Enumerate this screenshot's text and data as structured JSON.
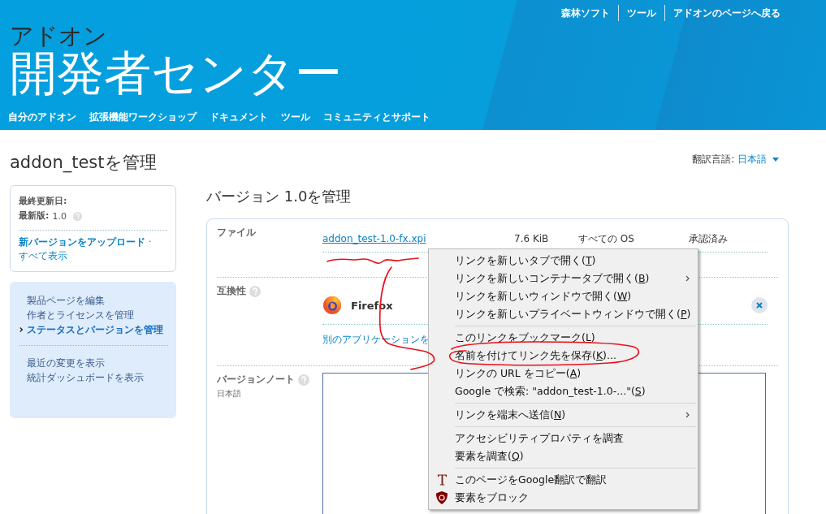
{
  "header": {
    "top_links": [
      "森林ソフト",
      "ツール",
      "アドオンのページへ戻る"
    ],
    "subtitle": "アドオン",
    "title": "開発者センター",
    "nav": [
      "自分のアドオン",
      "拡張機能ワークショップ",
      "ドキュメント",
      "ツール",
      "コミュニティとサポート"
    ]
  },
  "page_title": "addon_testを管理",
  "locale": {
    "label": "翻訳言語:",
    "value": "日本語"
  },
  "sidebar": {
    "updated_label": "最終更新日:",
    "version_label": "最新版:",
    "version": "1.0",
    "upload_link": "新バージョンをアップロード",
    "separator": "·",
    "all_link": "すべて表示",
    "nav_groups": [
      [
        {
          "label": "製品ページを編集",
          "selected": false
        },
        {
          "label": "作者とライセンスを管理",
          "selected": false
        },
        {
          "label": "ステータスとバージョンを管理",
          "selected": true
        }
      ],
      [
        {
          "label": "最近の変更を表示",
          "selected": false
        },
        {
          "label": "統計ダッシュボードを表示",
          "selected": false
        }
      ]
    ]
  },
  "main_title": "バージョン 1.0を管理",
  "files": {
    "label": "ファイル",
    "name": "addon_test-1.0-fx.xpi",
    "size": "7.6 KiB",
    "platform": "すべての OS",
    "status": "承認済み"
  },
  "compat": {
    "label": "互換性",
    "app": "Firefox",
    "add_link": "別のアプリケーションを"
  },
  "notes": {
    "label": "バージョンノート",
    "locale": "日本語"
  },
  "context_menu": [
    [
      {
        "before": "リンクを新しいタブで開く(",
        "key": "T",
        "after": ")",
        "submenu": false
      },
      {
        "before": "リンクを新しいコンテナータブで開く(",
        "key": "B",
        "after": ")",
        "submenu": true
      },
      {
        "before": "リンクを新しいウィンドウで開く(",
        "key": "W",
        "after": ")",
        "submenu": false
      },
      {
        "before": "リンクを新しいプライベートウィンドウで開く(",
        "key": "P",
        "after": ")",
        "submenu": false
      }
    ],
    [
      {
        "before": "このリンクをブックマーク(",
        "key": "L",
        "after": ")",
        "submenu": false
      },
      {
        "before": "名前を付けてリンク先を保存(",
        "key": "K",
        "after": ")...",
        "submenu": false
      },
      {
        "before": "リンクの URL をコピー(",
        "key": "A",
        "after": ")",
        "submenu": false
      },
      {
        "before": "Google で検索: \"addon_test-1.0-...\"(",
        "key": "S",
        "after": ")",
        "submenu": false
      }
    ],
    [
      {
        "before": "リンクを端末へ送信(",
        "key": "N",
        "after": ")",
        "submenu": true
      }
    ],
    [
      {
        "before": "アクセシビリティプロパティを調査",
        "submenu": false
      },
      {
        "before": "要素を調査(",
        "key": "Q",
        "after": ")",
        "submenu": false
      }
    ],
    [
      {
        "before": "このページをGoogle翻訳で翻訳",
        "kind": "translate",
        "submenu": false
      },
      {
        "before": "要素をブロック",
        "kind": "block",
        "submenu": false
      }
    ]
  ]
}
